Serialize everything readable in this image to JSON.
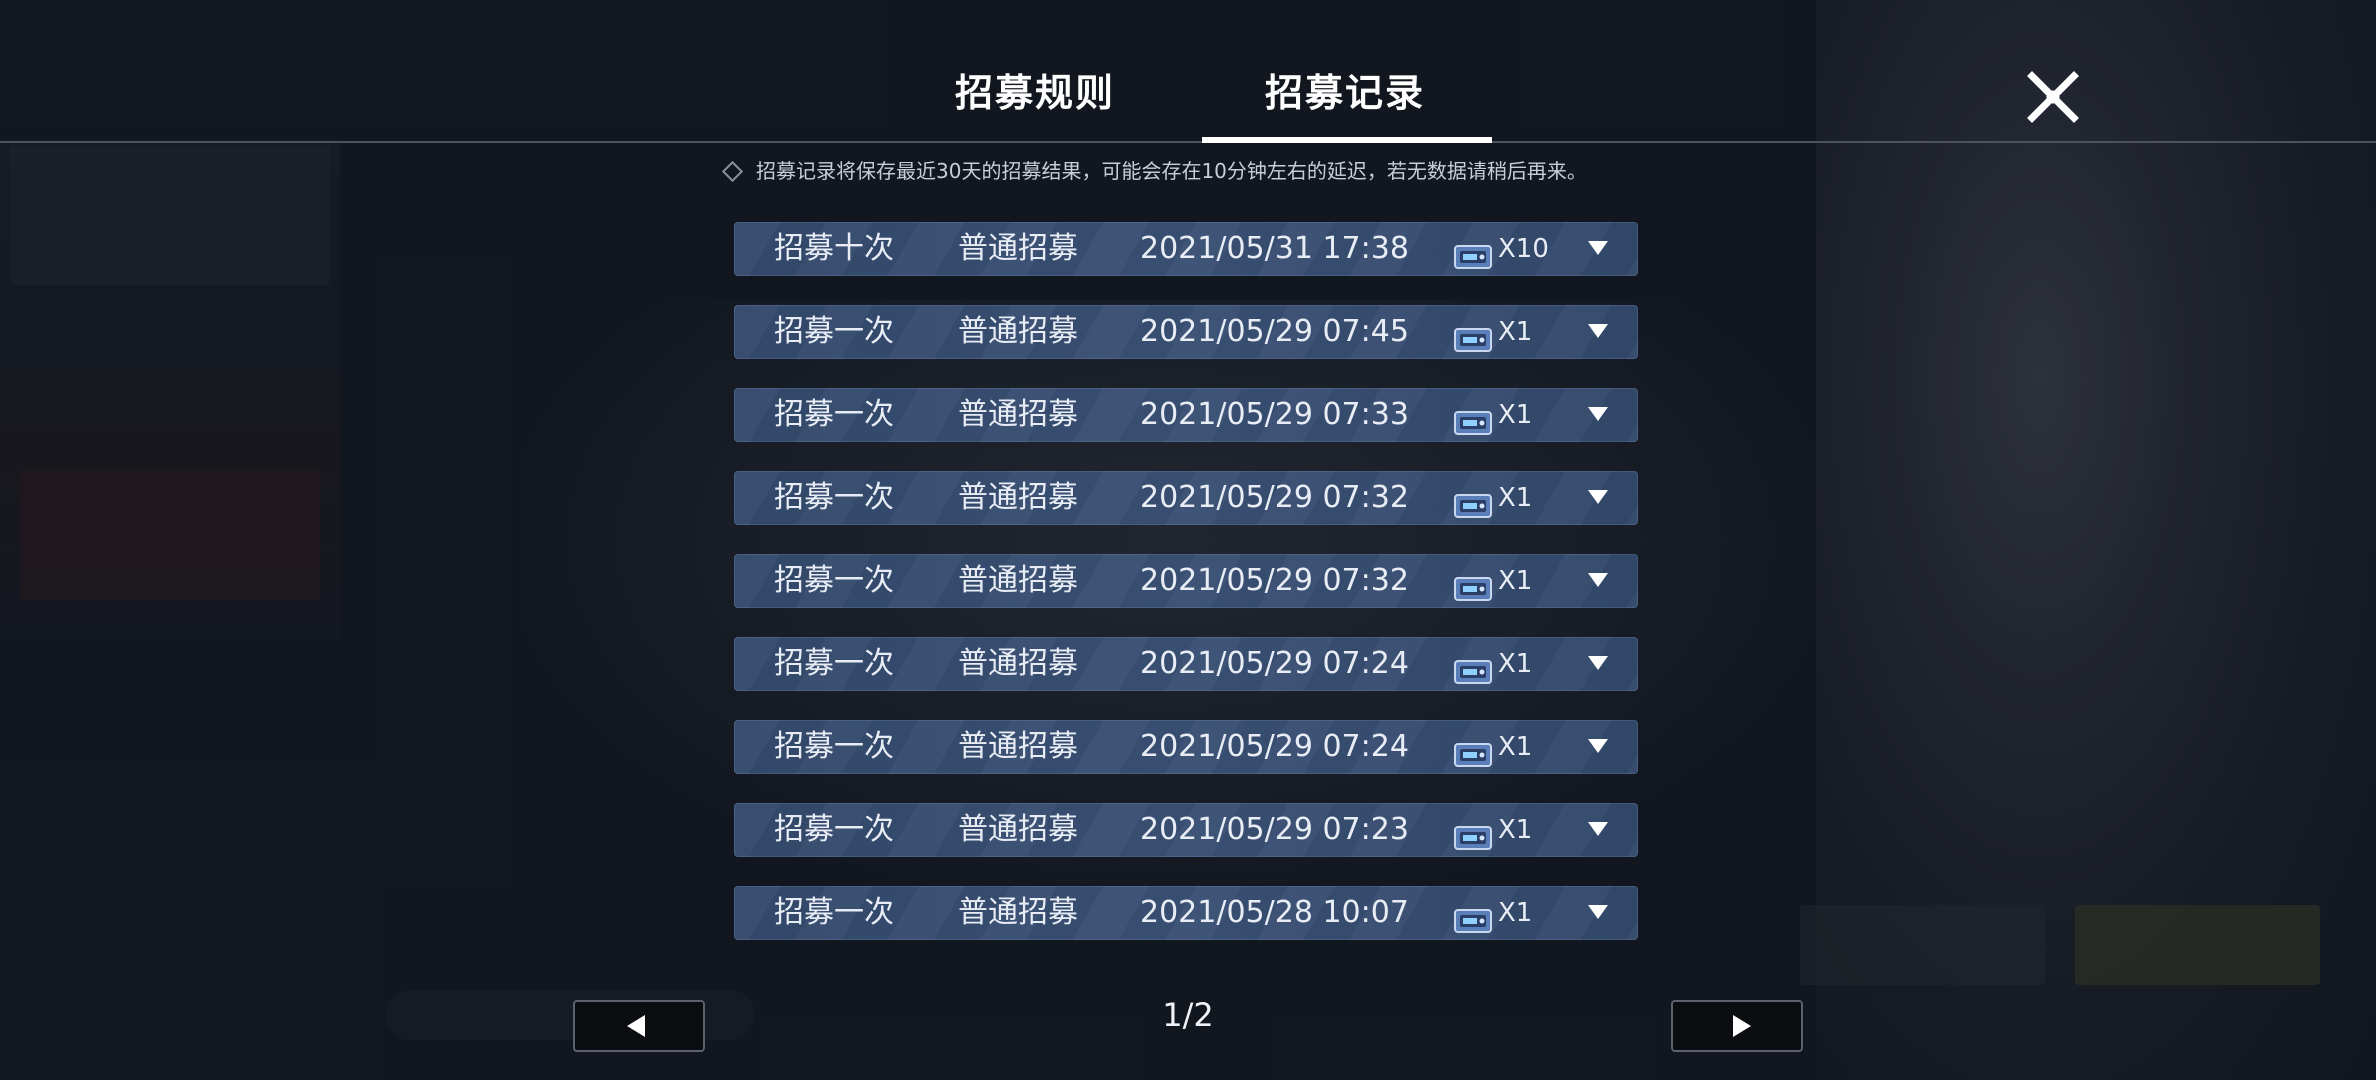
{
  "tabs": [
    {
      "label": "招募规则",
      "active": false
    },
    {
      "label": "招募记录",
      "active": true
    }
  ],
  "notice": "招募记录将保存最近30天的招募结果，可能会存在10分钟左右的延迟，若无数据请稍后再来。",
  "records": [
    {
      "type": "招募十次",
      "pool": "普通招募",
      "time": "2021/05/31 17:38",
      "count": "X10"
    },
    {
      "type": "招募一次",
      "pool": "普通招募",
      "time": "2021/05/29 07:45",
      "count": "X1"
    },
    {
      "type": "招募一次",
      "pool": "普通招募",
      "time": "2021/05/29 07:33",
      "count": "X1"
    },
    {
      "type": "招募一次",
      "pool": "普通招募",
      "time": "2021/05/29 07:32",
      "count": "X1"
    },
    {
      "type": "招募一次",
      "pool": "普通招募",
      "time": "2021/05/29 07:32",
      "count": "X1"
    },
    {
      "type": "招募一次",
      "pool": "普通招募",
      "time": "2021/05/29 07:24",
      "count": "X1"
    },
    {
      "type": "招募一次",
      "pool": "普通招募",
      "time": "2021/05/29 07:24",
      "count": "X1"
    },
    {
      "type": "招募一次",
      "pool": "普通招募",
      "time": "2021/05/29 07:23",
      "count": "X1"
    },
    {
      "type": "招募一次",
      "pool": "普通招募",
      "time": "2021/05/28 10:07",
      "count": "X1"
    }
  ],
  "pager": {
    "label": "1/2",
    "current": 1,
    "total": 2
  },
  "icons": {
    "close": "close-icon",
    "notice": "diamond-bullet-icon",
    "ticket": "recruit-ticket-icon",
    "expand": "chevron-down-icon",
    "prev": "arrow-left-icon",
    "next": "arrow-right-icon"
  },
  "colors": {
    "background": "#151b24",
    "row": "#3a5074",
    "text": "#e8edf5",
    "pager_button": "#0b0d11"
  }
}
